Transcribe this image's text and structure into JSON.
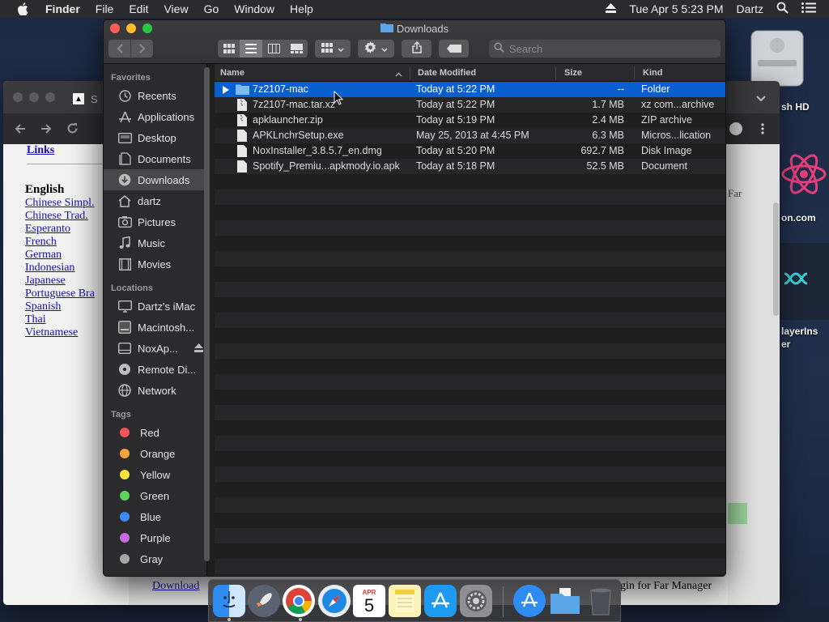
{
  "menubar": {
    "app_name": "Finder",
    "menus": [
      "File",
      "Edit",
      "View",
      "Go",
      "Window",
      "Help"
    ],
    "datetime": "Tue Apr 5  5:23 PM",
    "user": "Dartz"
  },
  "desktop": {
    "items": [
      "sh HD",
      "on.com",
      "layerIns",
      "er"
    ]
  },
  "browser": {
    "tab_fragment": "S",
    "links_header": "Links",
    "language_header": "English",
    "languages": [
      "Chinese Simpl.",
      "Chinese Trad.",
      "Esperanto",
      "French",
      "German",
      "Indonesian",
      "Japanese",
      "Portuguese Bra",
      "Spanish",
      "Thai",
      "Vietnamese"
    ],
    "download_link": "Download",
    "bottom_text": "gin for Far Manager",
    "right_text": "Far"
  },
  "finder": {
    "title": "Downloads",
    "search_placeholder": "Search",
    "sidebar": {
      "favorites_label": "Favorites",
      "favorites": [
        {
          "label": "Recents",
          "icon": "clock-icon"
        },
        {
          "label": "Applications",
          "icon": "applications-icon"
        },
        {
          "label": "Desktop",
          "icon": "desktop-icon"
        },
        {
          "label": "Documents",
          "icon": "documents-icon"
        },
        {
          "label": "Downloads",
          "icon": "downloads-icon",
          "selected": true
        },
        {
          "label": "dartz",
          "icon": "home-icon"
        },
        {
          "label": "Pictures",
          "icon": "pictures-icon"
        },
        {
          "label": "Music",
          "icon": "music-icon"
        },
        {
          "label": "Movies",
          "icon": "movies-icon"
        }
      ],
      "locations_label": "Locations",
      "locations": [
        {
          "label": "Dartz's iMac",
          "icon": "imac-icon"
        },
        {
          "label": "Macintosh...",
          "icon": "hard-drive-icon"
        },
        {
          "label": "NoxAp...",
          "icon": "disk-image-icon",
          "eject": true
        },
        {
          "label": "Remote Di...",
          "icon": "remote-disc-icon"
        },
        {
          "label": "Network",
          "icon": "network-icon"
        }
      ],
      "tags_label": "Tags",
      "tags": [
        {
          "label": "Red",
          "color": "#f0535a"
        },
        {
          "label": "Orange",
          "color": "#f5a23a"
        },
        {
          "label": "Yellow",
          "color": "#f6e03b"
        },
        {
          "label": "Green",
          "color": "#5cd35a"
        },
        {
          "label": "Blue",
          "color": "#3a8cf5"
        },
        {
          "label": "Purple",
          "color": "#c66ae3"
        },
        {
          "label": "Gray",
          "color": "#a6a6a6"
        }
      ]
    },
    "columns": {
      "name": "Name",
      "date": "Date Modified",
      "size": "Size",
      "kind": "Kind"
    },
    "files": [
      {
        "name": "7z2107-mac",
        "date": "Today at 5:22 PM",
        "size": "--",
        "kind": "Folder",
        "type": "folder",
        "selected": true
      },
      {
        "name": "7z2107-mac.tar.xz",
        "date": "Today at 5:22 PM",
        "size": "1.7 MB",
        "kind": "xz com...archive",
        "type": "file"
      },
      {
        "name": "apklauncher.zip",
        "date": "Today at 5:19 PM",
        "size": "2.4 MB",
        "kind": "ZIP archive",
        "type": "file"
      },
      {
        "name": "APKLnchrSetup.exe",
        "date": "May 25, 2013 at 4:45 PM",
        "size": "6.3 MB",
        "kind": "Micros...lication",
        "type": "file"
      },
      {
        "name": "NoxInstaller_3.8.5.7_en.dmg",
        "date": "Today at 5:20 PM",
        "size": "692.7 MB",
        "kind": "Disk Image",
        "type": "file"
      },
      {
        "name": "Spotify_Premiu...apkmody.io.apk",
        "date": "Today at 5:18 PM",
        "size": "52.5 MB",
        "kind": "Document",
        "type": "file"
      }
    ]
  },
  "dock": {
    "calendar_month": "APR",
    "calendar_day": "5"
  }
}
